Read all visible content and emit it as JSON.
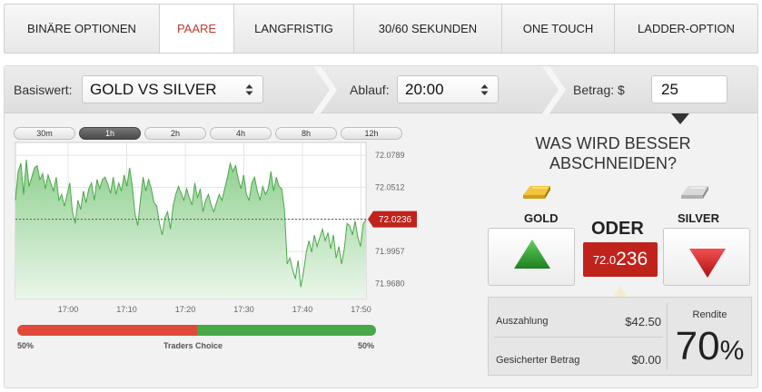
{
  "tabs": [
    {
      "label": "BINÄRE OPTIONEN",
      "active": false
    },
    {
      "label": "PAARE",
      "active": true
    },
    {
      "label": "LANGFRISTIG",
      "active": false
    },
    {
      "label": "30/60 SEKUNDEN",
      "active": false
    },
    {
      "label": "ONE TOUCH",
      "active": false
    },
    {
      "label": "LADDER-OPTION",
      "active": false
    }
  ],
  "toolbar": {
    "underlying_label": "Basiswert:",
    "underlying_value": "GOLD VS SILVER",
    "expiry_label": "Ablauf:",
    "expiry_value": "20:00",
    "amount_label": "Betrag: $",
    "amount_value": "25"
  },
  "ranges": [
    {
      "label": "30m",
      "active": false
    },
    {
      "label": "1h",
      "active": true
    },
    {
      "label": "2h",
      "active": false
    },
    {
      "label": "4h",
      "active": false
    },
    {
      "label": "8h",
      "active": false
    },
    {
      "label": "12h",
      "active": false
    }
  ],
  "chart_data": {
    "type": "area",
    "x_ticks": [
      "17:00",
      "17:10",
      "17:20",
      "17:30",
      "17:40",
      "17:50"
    ],
    "y_ticks": [
      72.0789,
      72.0512,
      72.0236,
      71.9957,
      71.968
    ],
    "ylim": [
      71.955,
      72.09
    ],
    "current_value": "72.0236",
    "grid": true,
    "series": [
      {
        "values": [
          72.04,
          72.065,
          72.072,
          72.045,
          72.075,
          72.052,
          72.06,
          72.068,
          72.07,
          72.058,
          72.063,
          72.05,
          72.062,
          72.055,
          72.048,
          72.06,
          72.04,
          72.045,
          72.035,
          72.045,
          72.055,
          72.03,
          72.02,
          72.04,
          72.032,
          72.048,
          72.038,
          72.05,
          72.055,
          72.04,
          72.058,
          72.05,
          72.058,
          72.06,
          72.054,
          72.046,
          72.06,
          72.045,
          72.055,
          72.048,
          72.062,
          72.052,
          72.068,
          72.052,
          72.028,
          72.018,
          72.04,
          72.06,
          72.048,
          72.058,
          72.05,
          72.038,
          72.035,
          72.02,
          72.01,
          72.025,
          72.03,
          72.015,
          72.035,
          72.045,
          72.052,
          72.046,
          72.04,
          72.05,
          72.042,
          72.036,
          72.055,
          72.042,
          72.05,
          72.03,
          72.04,
          72.045,
          72.036,
          72.03,
          72.038,
          72.045,
          72.04,
          72.05,
          72.06,
          72.072,
          72.065,
          72.07,
          72.058,
          72.05,
          72.062,
          72.045,
          72.04,
          72.055,
          72.06,
          72.048,
          72.04,
          72.052,
          72.045,
          72.05,
          72.065,
          72.048,
          72.06,
          72.052,
          72.05,
          72.032,
          71.985,
          71.99,
          71.98,
          71.972,
          71.988,
          71.965,
          71.978,
          71.995,
          72.005,
          71.995,
          72.01,
          72.0,
          72.008,
          72.015,
          72.005,
          72.012,
          71.998,
          72.01,
          71.99,
          72.0,
          71.985,
          71.998,
          72.02,
          72.018,
          72.01,
          72.022,
          72.008,
          72.0,
          72.02,
          72.023
        ]
      }
    ]
  },
  "sentiment": {
    "left_pct_label": "50%",
    "center_label": "Traders Choice",
    "right_pct_label": "50%",
    "left_fraction": 0.5,
    "left_color": "#e04a38",
    "right_color": "#46a846"
  },
  "trade": {
    "question": "WAS WIRD BESSER ABSCHNEIDEN?",
    "asset_a": "GOLD",
    "asset_b": "SILVER",
    "or_label": "ODER",
    "price_small": "72.0",
    "price_big": "236",
    "up_color": "#2e9a2e",
    "down_color": "#d41f1f"
  },
  "payout": {
    "payout_label": "Auszahlung",
    "payout_value": "$42.50",
    "secured_label": "Gesicherter Betrag",
    "secured_value": "$0.00",
    "return_label": "Rendite",
    "return_value": "70",
    "return_unit": "%"
  }
}
